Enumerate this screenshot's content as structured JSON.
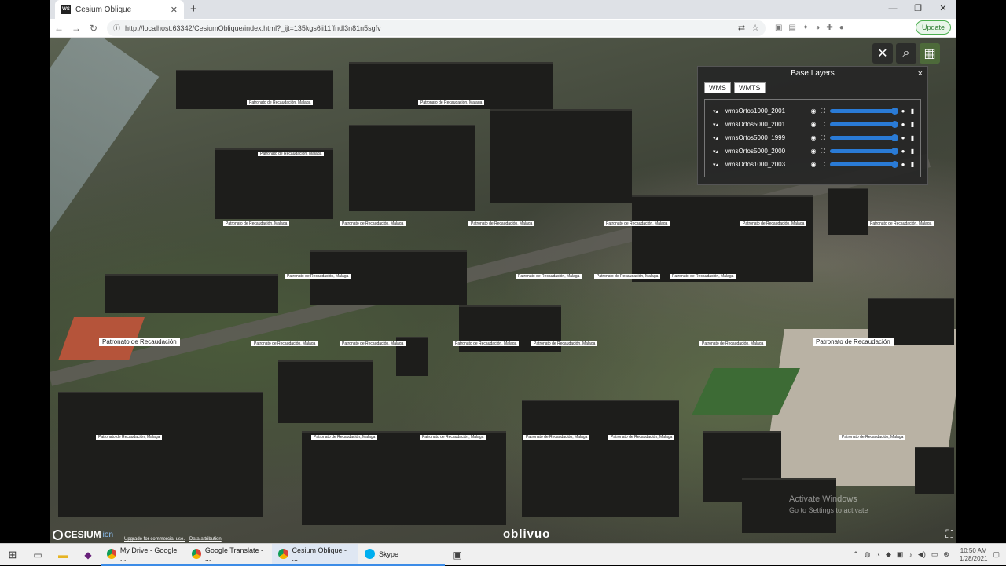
{
  "browser": {
    "tab_title": "Cesium Oblique",
    "tab_favicon": "WS",
    "new_tab_icon": "+",
    "url": "http://localhost:63342/CesiumOblique/index.html?_ijt=135kgs6ii11ffndl3n81n5sgfv",
    "update_label": "Update"
  },
  "layers_panel": {
    "title": "Base Layers",
    "close": "×",
    "tabs": [
      "WMS",
      "WMTS"
    ],
    "layers": [
      {
        "name": "wmsOrtos1000_2001",
        "opacity": 1.0
      },
      {
        "name": "wmsOrtos5000_2001",
        "opacity": 1.0
      },
      {
        "name": "wmsOrtos5000_1999",
        "opacity": 1.0
      },
      {
        "name": "wmsOrtos5000_2000",
        "opacity": 1.0
      },
      {
        "name": "wmsOrtos1000_2003",
        "opacity": 1.0
      }
    ]
  },
  "map": {
    "building_label": "Patronato de Recaudación, Malaga",
    "building_label_short": "Patronato de Recaudación",
    "credits": {
      "logo": "CESIUM",
      "logo_suffix": "ion",
      "upgrade": "Upgrade for commercial use.",
      "data": "Data attribution"
    },
    "brand": "oblivuo",
    "watermark_title": "Activate Windows",
    "watermark_sub": "Go to Settings to activate"
  },
  "taskbar": {
    "apps": [
      {
        "label": "My Drive - Google ..."
      },
      {
        "label": "Google Translate - ..."
      },
      {
        "label": "Cesium Oblique - ..."
      },
      {
        "label": "Skype"
      }
    ],
    "time": "10:50 AM",
    "date": "1/28/2021"
  }
}
